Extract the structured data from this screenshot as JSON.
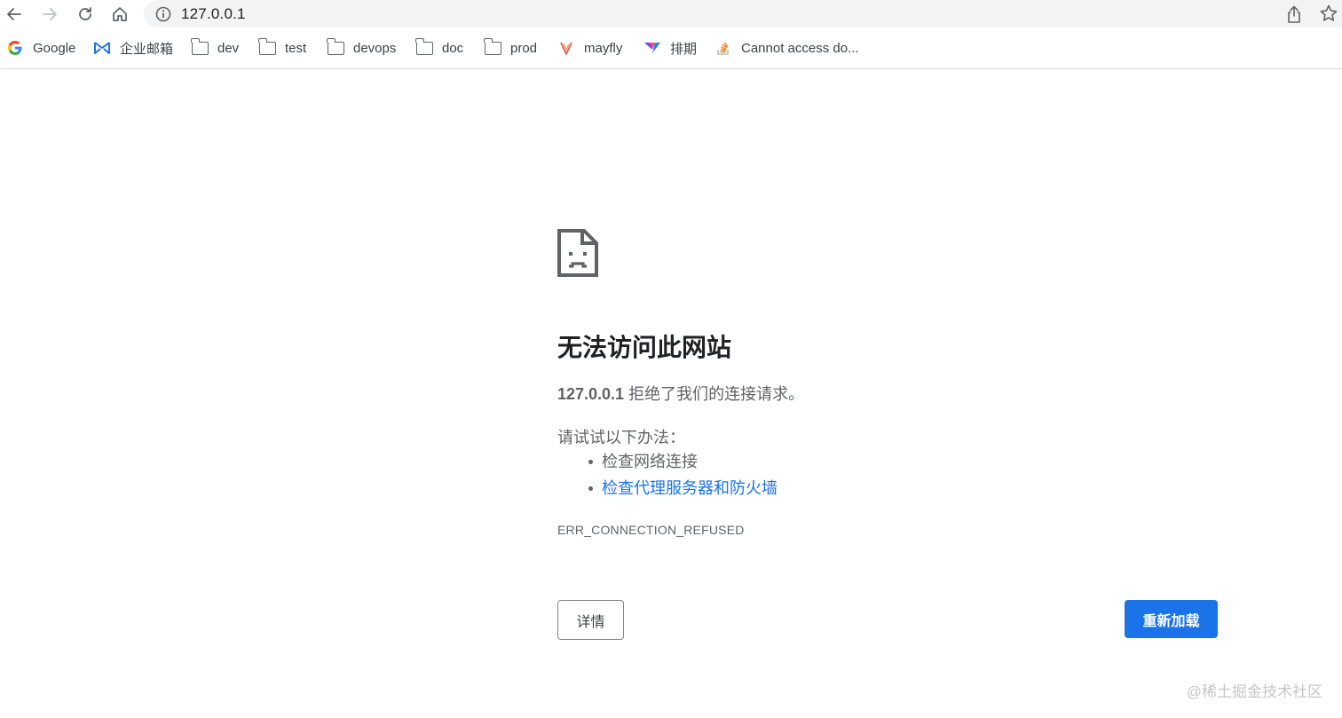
{
  "toolbar": {
    "url": "127.0.0.1",
    "icons": [
      "back-arrow-icon",
      "forward-arrow-icon",
      "reload-icon",
      "home-icon",
      "info-icon",
      "share-icon",
      "star-icon"
    ]
  },
  "bookmarks": [
    {
      "label": "Google",
      "icon": "google-logo-icon"
    },
    {
      "label": "企业邮箱",
      "icon": "mail-logo-icon"
    },
    {
      "label": "dev",
      "icon": "folder-icon"
    },
    {
      "label": "test",
      "icon": "folder-icon"
    },
    {
      "label": "devops",
      "icon": "folder-icon"
    },
    {
      "label": "doc",
      "icon": "folder-icon"
    },
    {
      "label": "prod",
      "icon": "folder-icon"
    },
    {
      "label": "mayfly",
      "icon": "mayfly-logo-icon"
    },
    {
      "label": "排期",
      "icon": "schedule-logo-icon"
    },
    {
      "label": "Cannot access do...",
      "icon": "stackoverflow-logo-icon"
    }
  ],
  "error": {
    "icon": "sad-document-icon",
    "title": "无法访问此网站",
    "host": "127.0.0.1",
    "message": " 拒绝了我们的连接请求。",
    "suggest_title": "请试试以下办法：",
    "suggestions": [
      {
        "text": "检查网络连接",
        "link": false
      },
      {
        "text": "检查代理服务器和防火墙",
        "link": true
      }
    ],
    "code": "ERR_CONNECTION_REFUSED",
    "details_label": "详情",
    "reload_label": "重新加载"
  },
  "watermark": "@稀土掘金技术社区",
  "colors": {
    "accent": "#1a73e8",
    "text_secondary": "#5f6368",
    "omnibox_bg": "#f1f3f4"
  }
}
